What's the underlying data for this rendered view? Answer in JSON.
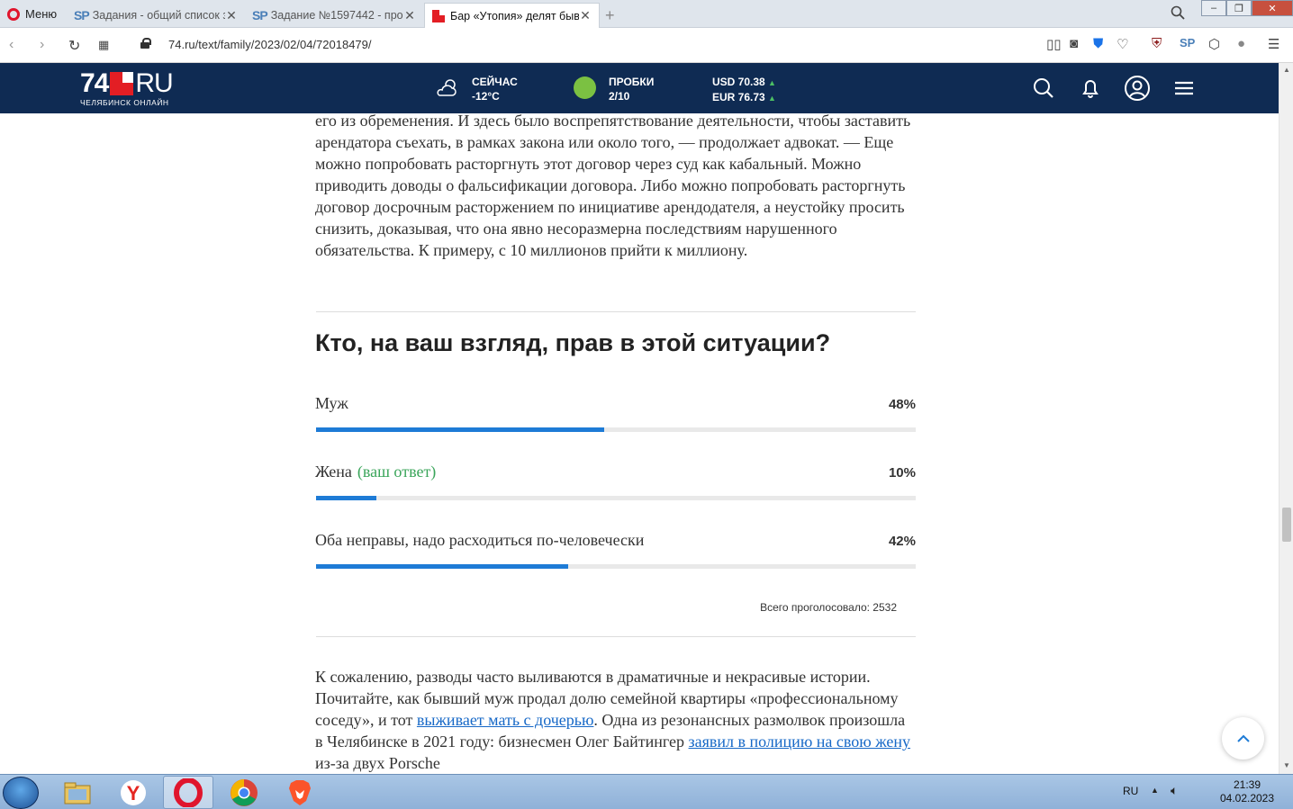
{
  "browser": {
    "menu_label": "Меню",
    "tabs": [
      {
        "title": "Задания - общий список з"
      },
      {
        "title": "Задание №1597442 - про"
      },
      {
        "title": "Бар «Утопия» делят бывш"
      }
    ],
    "url": "74.ru/text/family/2023/02/04/72018479/"
  },
  "site": {
    "logo_main": "74",
    "logo_ru": "RU",
    "logo_sub": "ЧЕЛЯБИНСК ОНЛАЙН",
    "weather_label": "СЕЙЧАС",
    "weather_value": "-12°C",
    "traffic_label": "ПРОБКИ",
    "traffic_value": "2/10",
    "usd": "USD 70.38",
    "eur": "EUR 76.73"
  },
  "article": {
    "paragraph_top": "его из обременения. И здесь было воспрепятствование деятельности, чтобы заставить арендатора съехать, в рамках закона или около того, — продолжает адвокат. — Еще можно попробовать расторгнуть этот договор через суд как кабальный. Можно приводить доводы о фальсификации договора. Либо можно попробовать расторгнуть договор досрочным расторжением по инициативе арендодателя, а неустойку просить снизить, доказывая, что она явно несоразмерна последствиям нарушенного обязательства. К примеру, с 10 миллионов прийти к миллиону.",
    "bottom_p1": "К сожалению, разводы часто выливаются в драматичные и некрасивые истории. Почитайте, как бывший муж продал долю семейной квартиры «профессиональному соседу», и тот ",
    "bottom_link1": "выживает мать с дочерью",
    "bottom_p2": ". Одна из резонансных размолвок произошла в Челябинске в 2021 году: бизнесмен Олег Байтингер ",
    "bottom_link2": "заявил в полицию на свою жену",
    "bottom_p3": " из-за двух Porsche"
  },
  "poll": {
    "question": "Кто, на ваш взгляд, прав в этой ситуации?",
    "options": [
      {
        "label": "Муж",
        "percent_text": "48%",
        "percent": 48,
        "mine": ""
      },
      {
        "label": "Жена",
        "percent_text": "10%",
        "percent": 10,
        "mine": "(ваш ответ)"
      },
      {
        "label": "Оба неправы, надо расходиться по-человечески",
        "percent_text": "42%",
        "percent": 42,
        "mine": ""
      }
    ],
    "total": "Всего проголосовало: 2532",
    "bar_color": "#1e7bd6"
  },
  "taskbar": {
    "lang": "RU",
    "time": "21:39",
    "date": "04.02.2023"
  }
}
